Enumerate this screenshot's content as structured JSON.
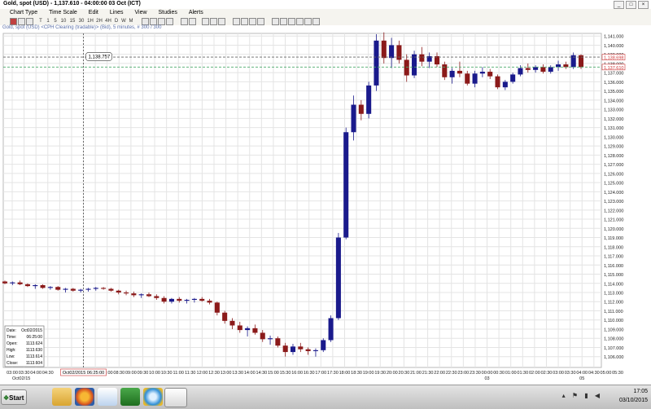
{
  "window": {
    "title": "Gold, spot (USD) - 1,137.610 - 04:00:00 03 Oct (ICT)"
  },
  "menu": [
    "Chart Type",
    "Time Scale",
    "Edit",
    "Lines",
    "View",
    "Studies",
    "Alerts"
  ],
  "toolbar": {
    "buttons": [
      "T",
      "1",
      "5",
      "10",
      "15",
      "30",
      "1H",
      "2H",
      "4H",
      "D",
      "W",
      "M"
    ]
  },
  "chart_caption": "Gold, spot (USD) <CPH Clearing (tradable)> (Bid), 5 minutes, # 300 / 300",
  "chart_data": {
    "type": "candlestick",
    "ylim": [
      1105.0,
      1142.0
    ],
    "y_ticks": [
      "1,141.000",
      "1,140.000",
      "1,139.000",
      "1,138.000",
      "1,137.000",
      "1,136.000",
      "1,135.000",
      "1,134.000",
      "1,133.000",
      "1,132.000",
      "1,131.000",
      "1,130.000",
      "1,129.000",
      "1,128.000",
      "1,127.000",
      "1,126.000",
      "1,125.000",
      "1,124.000",
      "1,123.000",
      "1,122.000",
      "1,121.000",
      "1,120.000",
      "1,119.000",
      "1,118.000",
      "1,117.000",
      "1,116.000",
      "1,115.000",
      "1,114.000",
      "1,113.000",
      "1,112.000",
      "1,111.000",
      "1,110.000",
      "1,109.000",
      "1,108.000",
      "1,107.000",
      "1,106.000"
    ],
    "price_labels": [
      {
        "text": "1,138.698",
        "value": 1138.698,
        "color": "#cc3333"
      },
      {
        "text": "1,137.610",
        "value": 1137.61,
        "color": "#cc3333"
      }
    ],
    "hlines": [
      1138.7,
      1137.61
    ],
    "x_ticks": [
      "03:00",
      "03:30",
      "04:00",
      "04:30",
      "",
      "05",
      "",
      "07:30",
      "08:00",
      "08:30",
      "09:00",
      "09:30",
      "10:00",
      "10:30",
      "11:00",
      "11:30",
      "12:00",
      "12:30",
      "13:00",
      "13:30",
      "14:00",
      "14:30",
      "15:00",
      "15:30",
      "16:00",
      "16:30",
      "17:00",
      "17:30",
      "18:00",
      "18:30",
      "19:00",
      "19:30",
      "20:00",
      "20:30",
      "21:00",
      "21:30",
      "22:00",
      "22:30",
      "23:00",
      "23:30",
      "00:00",
      "00:30",
      "01:00",
      "01:30",
      "02:00",
      "02:30",
      "03:00",
      "03:30",
      "04:00",
      "04:30",
      "05:00",
      "05:30"
    ],
    "x_date_labels": [
      {
        "text": "Oct02/15",
        "tick": 0
      },
      {
        "text": "03",
        "tick": 40
      },
      {
        "text": "05",
        "tick": 48
      }
    ],
    "crosshair": {
      "tick": 6,
      "date_text": "Oct02/2015 06:25:00",
      "price_text": "1,138.757",
      "price": 1138.757
    },
    "ohlc": [
      [
        1114.2,
        1114.3,
        1113.9,
        1114.0
      ],
      [
        1114.0,
        1114.2,
        1113.8,
        1114.1
      ],
      [
        1114.1,
        1114.3,
        1113.8,
        1113.9
      ],
      [
        1113.9,
        1114.0,
        1113.6,
        1113.7
      ],
      [
        1113.7,
        1113.9,
        1113.4,
        1113.8
      ],
      [
        1113.8,
        1113.9,
        1113.4,
        1113.5
      ],
      [
        1113.5,
        1113.7,
        1113.3,
        1113.6
      ],
      [
        1113.6,
        1113.7,
        1113.2,
        1113.3
      ],
      [
        1113.3,
        1113.5,
        1113.0,
        1113.4
      ],
      [
        1113.4,
        1113.5,
        1113.1,
        1113.2
      ],
      [
        1113.2,
        1113.4,
        1113.0,
        1113.3
      ],
      [
        1113.3,
        1113.5,
        1113.1,
        1113.4
      ],
      [
        1113.4,
        1113.6,
        1113.2,
        1113.5
      ],
      [
        1113.5,
        1113.6,
        1113.3,
        1113.4
      ],
      [
        1113.4,
        1113.5,
        1113.1,
        1113.2
      ],
      [
        1113.2,
        1113.3,
        1112.8,
        1113.0
      ],
      [
        1113.0,
        1113.2,
        1112.7,
        1112.9
      ],
      [
        1112.9,
        1113.1,
        1112.5,
        1112.7
      ],
      [
        1112.7,
        1112.9,
        1112.4,
        1112.8
      ],
      [
        1112.8,
        1113.0,
        1112.5,
        1112.6
      ],
      [
        1112.6,
        1112.8,
        1112.2,
        1112.4
      ],
      [
        1112.4,
        1112.6,
        1111.8,
        1112.0
      ],
      [
        1112.0,
        1112.4,
        1111.8,
        1112.3
      ],
      [
        1112.3,
        1112.5,
        1111.9,
        1112.1
      ],
      [
        1112.1,
        1112.3,
        1111.8,
        1112.2
      ],
      [
        1112.2,
        1112.4,
        1111.9,
        1112.3
      ],
      [
        1112.3,
        1112.5,
        1112.0,
        1112.1
      ],
      [
        1112.1,
        1112.3,
        1111.7,
        1111.9
      ],
      [
        1111.9,
        1112.0,
        1110.5,
        1110.8
      ],
      [
        1110.8,
        1111.0,
        1109.6,
        1109.9
      ],
      [
        1109.9,
        1110.2,
        1109.0,
        1109.4
      ],
      [
        1109.4,
        1109.8,
        1108.6,
        1108.9
      ],
      [
        1108.9,
        1109.3,
        1108.2,
        1109.1
      ],
      [
        1109.1,
        1109.5,
        1108.4,
        1108.6
      ],
      [
        1108.6,
        1108.9,
        1107.6,
        1107.9
      ],
      [
        1107.9,
        1108.3,
        1107.3,
        1108.0
      ],
      [
        1108.0,
        1108.2,
        1107.0,
        1107.2
      ],
      [
        1107.2,
        1107.5,
        1106.0,
        1106.5
      ],
      [
        1106.5,
        1107.4,
        1106.2,
        1107.1
      ],
      [
        1107.1,
        1107.5,
        1106.5,
        1106.8
      ],
      [
        1106.8,
        1107.0,
        1106.2,
        1106.6
      ],
      [
        1106.6,
        1106.9,
        1106.0,
        1106.7
      ],
      [
        1106.7,
        1108.0,
        1106.5,
        1107.8
      ],
      [
        1107.8,
        1110.5,
        1107.6,
        1110.2
      ],
      [
        1110.2,
        1119.5,
        1110.0,
        1119.0
      ],
      [
        1119.0,
        1131.0,
        1118.8,
        1130.5
      ],
      [
        1130.5,
        1134.5,
        1129.6,
        1133.5
      ],
      [
        1133.5,
        1134.0,
        1131.8,
        1132.5
      ],
      [
        1132.5,
        1136.0,
        1132.0,
        1135.6
      ],
      [
        1135.6,
        1141.2,
        1135.0,
        1140.5
      ],
      [
        1140.5,
        1141.4,
        1138.0,
        1138.6
      ],
      [
        1138.6,
        1140.8,
        1137.5,
        1140.0
      ],
      [
        1140.0,
        1140.5,
        1138.0,
        1138.4
      ],
      [
        1138.4,
        1139.0,
        1136.0,
        1136.7
      ],
      [
        1136.7,
        1139.4,
        1136.4,
        1139.0
      ],
      [
        1139.0,
        1139.8,
        1137.7,
        1138.2
      ],
      [
        1138.2,
        1139.2,
        1137.5,
        1138.8
      ],
      [
        1138.8,
        1139.2,
        1137.6,
        1137.9
      ],
      [
        1137.9,
        1138.2,
        1136.2,
        1136.5
      ],
      [
        1136.5,
        1137.5,
        1135.8,
        1137.2
      ],
      [
        1137.2,
        1138.2,
        1136.5,
        1136.9
      ],
      [
        1136.9,
        1137.2,
        1135.6,
        1135.8
      ],
      [
        1135.8,
        1137.2,
        1135.4,
        1136.9
      ],
      [
        1136.9,
        1137.6,
        1136.5,
        1137.1
      ],
      [
        1137.1,
        1137.4,
        1136.3,
        1136.6
      ],
      [
        1136.6,
        1136.8,
        1135.2,
        1135.4
      ],
      [
        1135.4,
        1136.2,
        1135.1,
        1136.0
      ],
      [
        1136.0,
        1137.0,
        1135.8,
        1136.8
      ],
      [
        1136.8,
        1137.8,
        1136.6,
        1137.5
      ],
      [
        1137.5,
        1138.0,
        1137.0,
        1137.3
      ],
      [
        1137.3,
        1137.8,
        1137.0,
        1137.6
      ],
      [
        1137.6,
        1137.9,
        1136.9,
        1137.1
      ],
      [
        1137.1,
        1137.8,
        1136.9,
        1137.6
      ],
      [
        1137.6,
        1138.3,
        1137.2,
        1137.9
      ],
      [
        1137.9,
        1138.2,
        1137.4,
        1137.6
      ],
      [
        1137.6,
        1139.2,
        1137.4,
        1138.9
      ],
      [
        1138.9,
        1139.0,
        1137.4,
        1137.6
      ]
    ]
  },
  "info_box": [
    {
      "label": "Date:",
      "value": "Oct02/2015"
    },
    {
      "label": "Time:",
      "value": "06:25:00"
    },
    {
      "label": "Open:",
      "value": "1113.624"
    },
    {
      "label": "High:",
      "value": "1113.630"
    },
    {
      "label": "Low:",
      "value": "1113.614"
    },
    {
      "label": "Close:",
      "value": "1113.604"
    }
  ],
  "taskbar": {
    "start_label": "Start",
    "apps": [
      "folder-icon",
      "firefox-icon",
      "document-icon",
      "excel-icon",
      "ie-icon",
      "chart-app-icon"
    ]
  },
  "tray": {
    "time": "17:05",
    "date": "03/10/2015"
  },
  "colors": {
    "up": "#1a1a8c",
    "down": "#8b1a1a",
    "grid": "#e4e4e4",
    "hline_a": "#666666",
    "hline_b": "#4aa86a"
  }
}
